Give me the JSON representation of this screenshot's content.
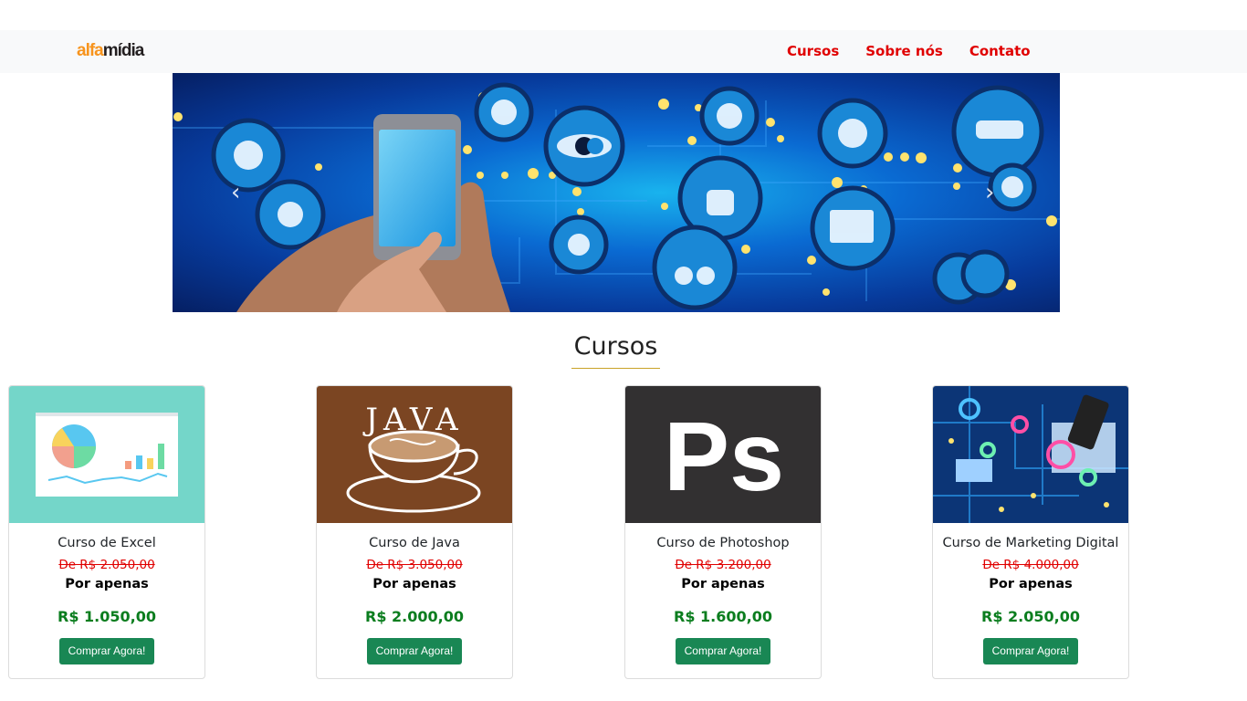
{
  "brand": {
    "logo_part1": "alfa",
    "logo_part2": "mídia"
  },
  "nav": {
    "items": [
      "Cursos",
      "Sobre nós",
      "Contato"
    ]
  },
  "carousel": {
    "prev_icon": "chevron-left-icon",
    "next_icon": "chevron-right-icon"
  },
  "section": {
    "title": "Cursos"
  },
  "courses": [
    {
      "title": "Curso de Excel",
      "old_price": "De R$ 2.050,00",
      "label": "Por apenas",
      "price": "R$ 1.050,00",
      "button": "Comprar Agora!"
    },
    {
      "title": "Curso de Java",
      "old_price": "De R$ 3.050,00",
      "label": "Por apenas",
      "price": "R$ 2.000,00",
      "button": "Comprar Agora!",
      "image_text": "JAVA"
    },
    {
      "title": "Curso de Photoshop",
      "old_price": "De R$ 3.200,00",
      "label": "Por apenas",
      "price": "R$ 1.600,00",
      "button": "Comprar Agora!",
      "image_text": "Ps"
    },
    {
      "title": "Curso de Marketing Digital",
      "old_price": "De R$ 4.000,00",
      "label": "Por apenas",
      "price": "R$ 2.050,00",
      "button": "Comprar Agora!"
    }
  ],
  "colors": {
    "nav_link": "#e00000",
    "price": "#0a7d1e",
    "old_price": "#e00000",
    "button": "#198754",
    "navbar_bg": "#f8f9fa"
  }
}
